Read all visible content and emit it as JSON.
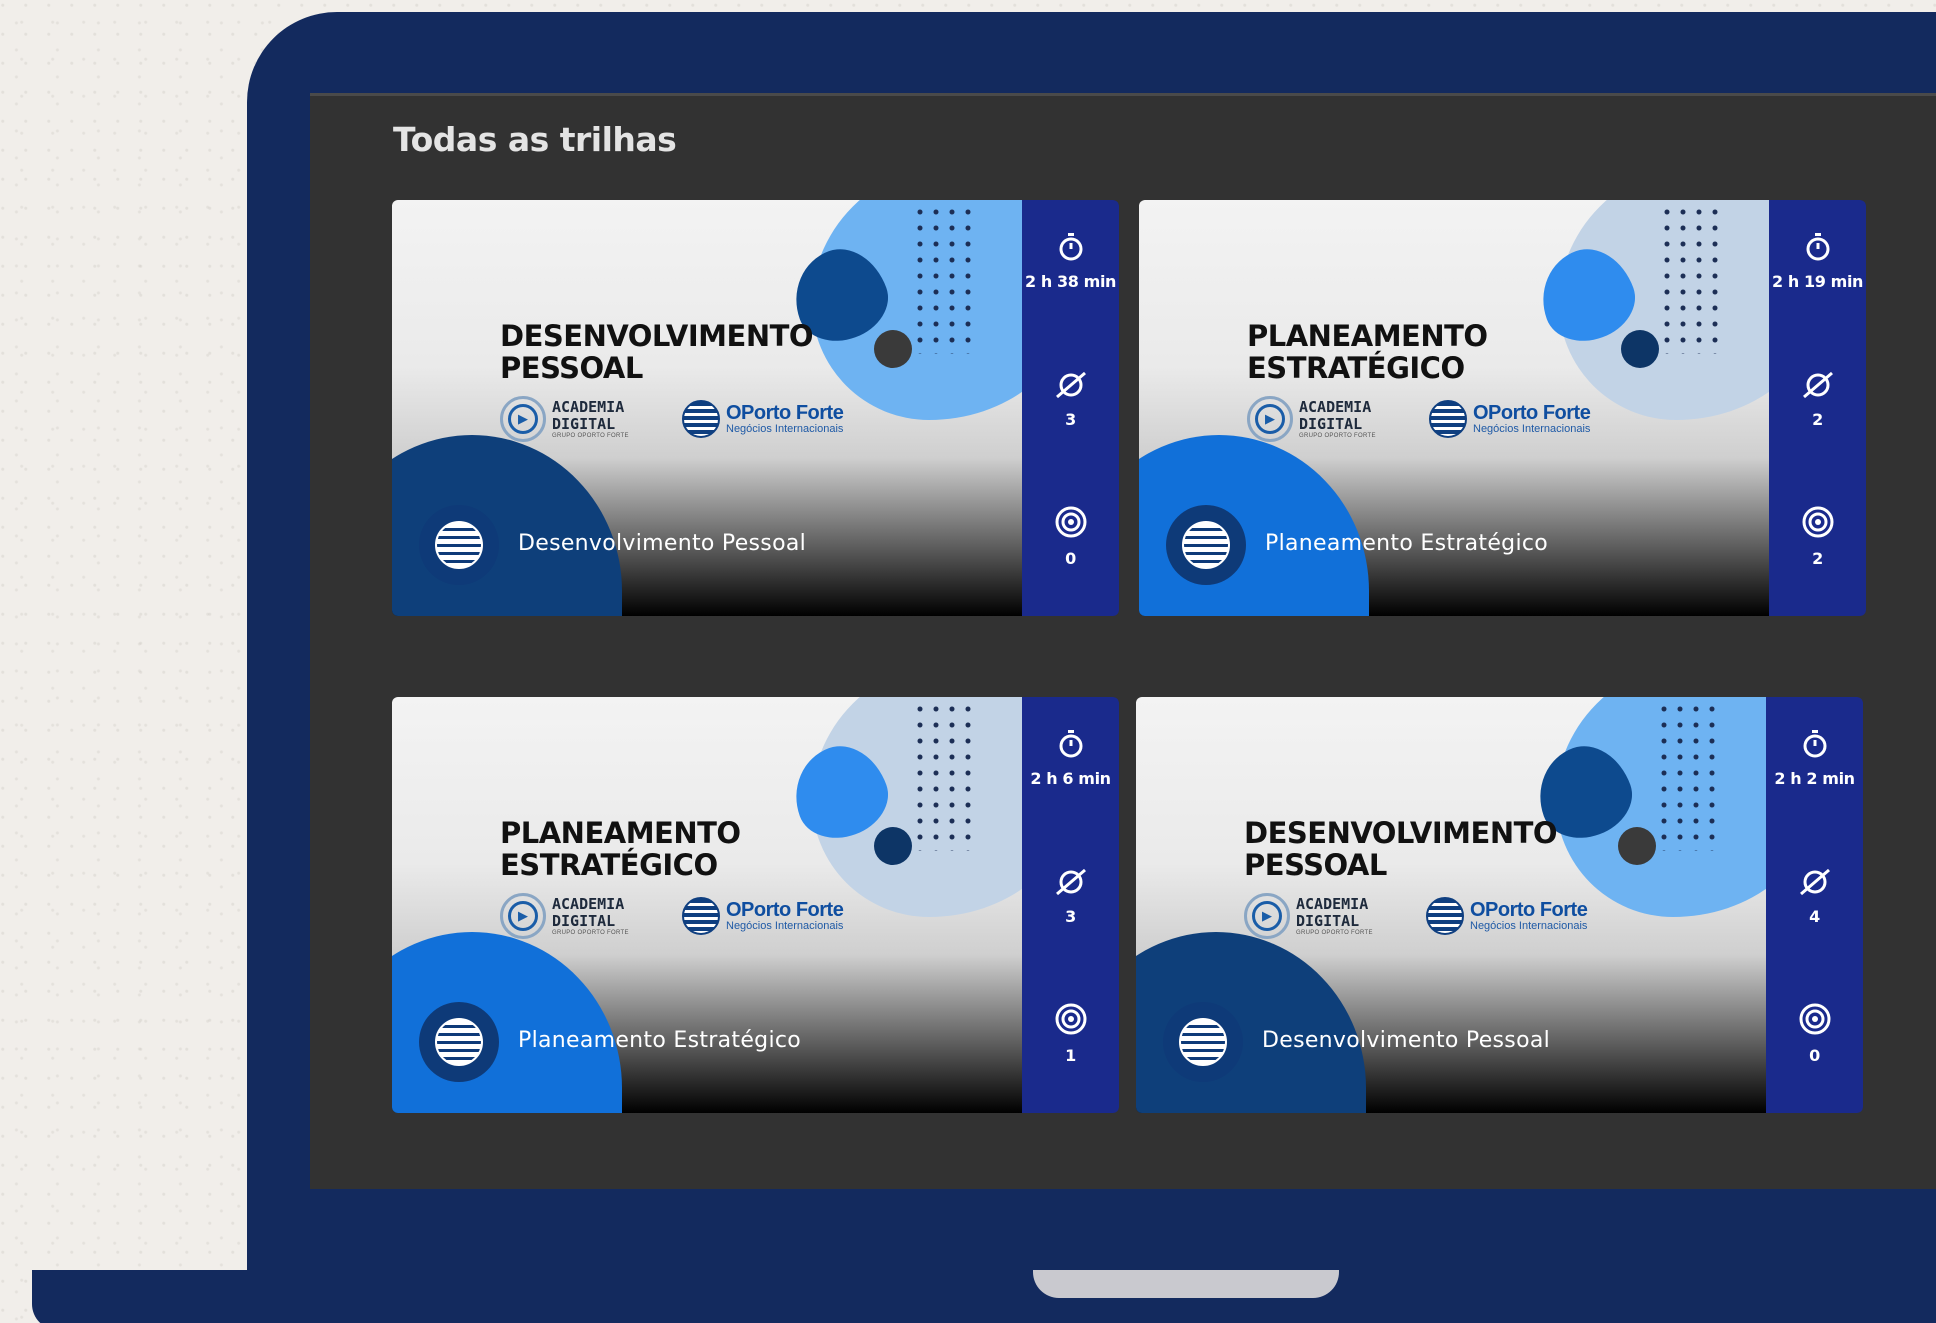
{
  "page": {
    "section_title": "Todas as trilhas"
  },
  "brand": {
    "academia_line1": "ACADEMIA",
    "academia_line2": "DIGITAL",
    "academia_sub": "GRUPO OPORTO FORTE",
    "oporto_name": "OPorto Forte",
    "oporto_tagline": "Negócios Internacionais"
  },
  "colors": {
    "laptop_frame": "#132a5e",
    "screen_bg": "#323232",
    "stats_bar": "#1a2a8c",
    "accent_blue": "#0f4ea0"
  },
  "icons": {
    "duration": "stopwatch-icon",
    "courses": "planet-icon",
    "goals": "target-icon",
    "brand": "striped-globe-icon"
  },
  "cards": [
    {
      "title_line1": "DESENVOLVIMENTO",
      "title_line2": "PESSOAL",
      "caption": "Desenvolvimento Pessoal",
      "duration": "2 h 38 min",
      "courses": "3",
      "goals": "0"
    },
    {
      "title_line1": "PLANEAMENTO",
      "title_line2": "ESTRATÉGICO",
      "caption": "Planeamento Estratégico",
      "duration": "2 h 19 min",
      "courses": "2",
      "goals": "2"
    },
    {
      "title_line1": "PLANEAMENTO",
      "title_line2": "ESTRATÉGICO",
      "caption": "Planeamento Estratégico",
      "duration": "2 h 6 min",
      "courses": "3",
      "goals": "1"
    },
    {
      "title_line1": "DESENVOLVIMENTO",
      "title_line2": "PESSOAL",
      "caption": "Desenvolvimento Pessoal",
      "duration": "2 h 2 min",
      "courses": "4",
      "goals": "0"
    }
  ]
}
